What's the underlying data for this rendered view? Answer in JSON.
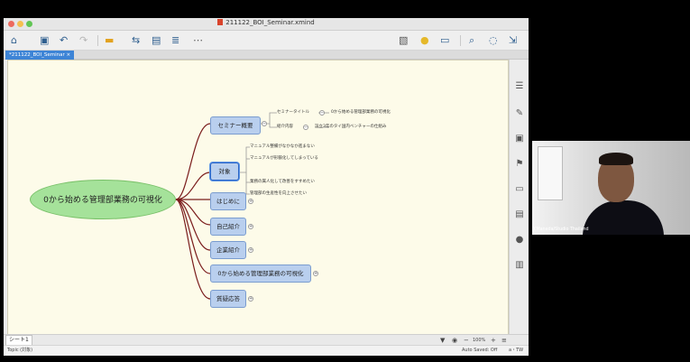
{
  "window": {
    "title": "211122_BOI_Seminar.xmind",
    "tab_label": "*211122_BOI_Seminar"
  },
  "toolbar": {
    "icons": [
      "home-icon",
      "save-icon",
      "undo-icon",
      "redo-icon",
      "topic-icon",
      "relationship-icon",
      "boundary-icon",
      "summary-icon",
      "more-icon",
      "insert-image-icon",
      "idea-icon",
      "layout-icon",
      "zoom-icon",
      "share-icon",
      "export-icon"
    ]
  },
  "mindmap": {
    "central_topic": "0から始める管理部業務の可視化",
    "topics": [
      {
        "label": "セミナー概要"
      },
      {
        "label": "対象"
      },
      {
        "label": "はじめに"
      },
      {
        "label": "自己紹介"
      },
      {
        "label": "企業紹介"
      },
      {
        "label": "0から始める管理部業務の可視化"
      },
      {
        "label": "質疑応答"
      }
    ],
    "seminar_overview": {
      "rows": [
        {
          "key": "セミナータイトル",
          "value": "0から始める管理部業務の可視化"
        },
        {
          "key": "紹介内容",
          "value": "設立3年のタイ国内ベンチャーの仕組み"
        }
      ]
    },
    "target_items": [
      "マニュアル整備がなかなか進まない",
      "マニュアルが形骸化してしまっている",
      "業務の属人化して改善をすすめたい",
      "管理部の生産性を向上させたい"
    ]
  },
  "sheet": {
    "tab": "シート1",
    "zoom": "100%",
    "minus": "−",
    "plus": "+"
  },
  "status": {
    "left": "Topic (対象)",
    "autosave": "Auto Saved: Off",
    "lang": "a・TW"
  },
  "video": {
    "label": "Y.Maneda/Studio Thailand"
  },
  "colors": {
    "topic_fill": "#b9cfee",
    "central_fill": "#a5e29a",
    "branch": "#7a1c1c",
    "canvas": "#fdfbe9"
  }
}
